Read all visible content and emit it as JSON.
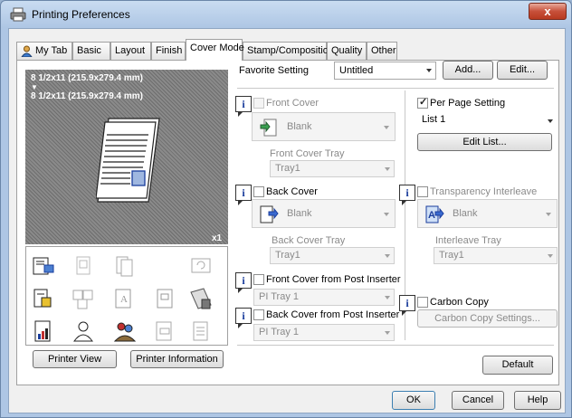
{
  "window": {
    "title": "Printing Preferences",
    "close_glyph": "x"
  },
  "tabs": [
    "My Tab",
    "Basic",
    "Layout",
    "Finish",
    "Cover Mode",
    "Stamp/Composition",
    "Quality",
    "Other"
  ],
  "active_tab": "Cover Mode",
  "preview": {
    "paper_top": "8 1/2x11 (215.9x279.4 mm)",
    "arrow": "▼",
    "paper_bottom": "8 1/2x11 (215.9x279.4 mm)",
    "copies": "x1"
  },
  "left_buttons": {
    "printer_view": "Printer View",
    "printer_information": "Printer Information"
  },
  "favorite": {
    "label": "Favorite Setting",
    "value": "Untitled",
    "add": "Add...",
    "edit": "Edit..."
  },
  "front_cover": {
    "label": "Front Cover",
    "value": "Blank",
    "tray_label": "Front Cover Tray",
    "tray_value": "Tray1"
  },
  "back_cover": {
    "label": "Back Cover",
    "value": "Blank",
    "tray_label": "Back Cover Tray",
    "tray_value": "Tray1"
  },
  "front_cover_pi": {
    "label": "Front Cover from Post Inserter",
    "value": "PI Tray 1"
  },
  "back_cover_pi": {
    "label": "Back Cover from Post Inserter",
    "value": "PI Tray 1"
  },
  "per_page": {
    "label": "Per Page Setting",
    "checked": true,
    "list_value": "List 1",
    "edit_list": "Edit List..."
  },
  "transparency": {
    "label": "Transparency Interleave",
    "value": "Blank",
    "tray_label": "Interleave Tray",
    "tray_value": "Tray1"
  },
  "carbon_copy": {
    "label": "Carbon Copy",
    "settings": "Carbon Copy Settings..."
  },
  "default_button": "Default",
  "bottom_buttons": {
    "ok": "OK",
    "cancel": "Cancel",
    "help": "Help"
  },
  "info_glyph": "i",
  "colors": {
    "title_bg": "#aec6e4",
    "close": "#c7503a",
    "preview_bg": "#7a7a7a",
    "accent_blue": "#1a3d9c"
  }
}
